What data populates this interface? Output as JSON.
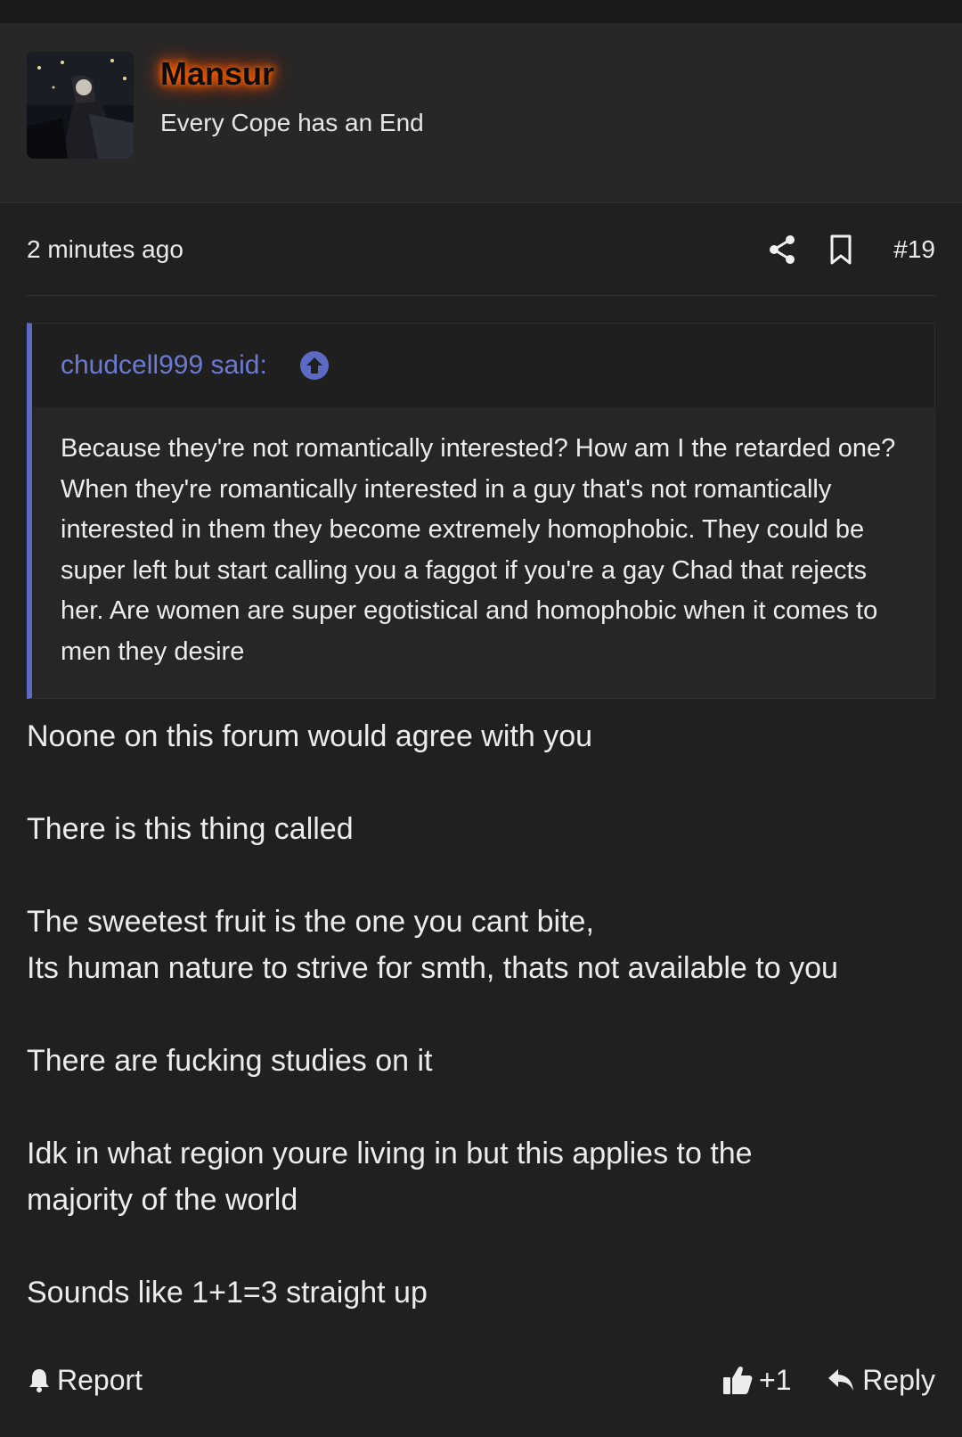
{
  "post": {
    "author": {
      "name": "Mansur",
      "title": "Every Cope has an End"
    },
    "meta": {
      "timestamp": "2 minutes ago",
      "post_number": "#19"
    },
    "quote": {
      "author_label": "chudcell999 said:",
      "text": "Because they're not romantically interested? How am I the retarded one? When they're romantically interested in a guy that's not romantically interested in them they become extremely homophobic. They could be super left but start calling you a faggot if you're a gay Chad that rejects her. Are women are super egotistical and homophobic when it comes to men they desire"
    },
    "message": {
      "p1": "Noone on this forum would agree with you",
      "p2": "There is this thing called",
      "p3_line1": "The sweetest fruit is the one you cant bite,",
      "p3_line2": "Its human nature to strive for smth, thats not available to you",
      "p4": "There are fucking studies on it",
      "p5_line1": "Idk in what region youre living in but this applies to the",
      "p5_line2": "majority of the world",
      "p6": "Sounds like 1+1=3 straight up"
    },
    "actions": {
      "report_label": "Report",
      "like_label": "+1",
      "reply_label": "Reply"
    }
  },
  "colors": {
    "background": "#202020",
    "header_background": "#272727",
    "quote_accent": "#5c6ac4",
    "username_glow": "#ff6a00"
  },
  "icons": {
    "share": "share-icon",
    "bookmark": "bookmark-icon",
    "quote_jump": "arrow-up-circle-icon",
    "report": "bell-icon",
    "like": "thumbs-up-icon",
    "reply": "reply-arrow-icon"
  }
}
